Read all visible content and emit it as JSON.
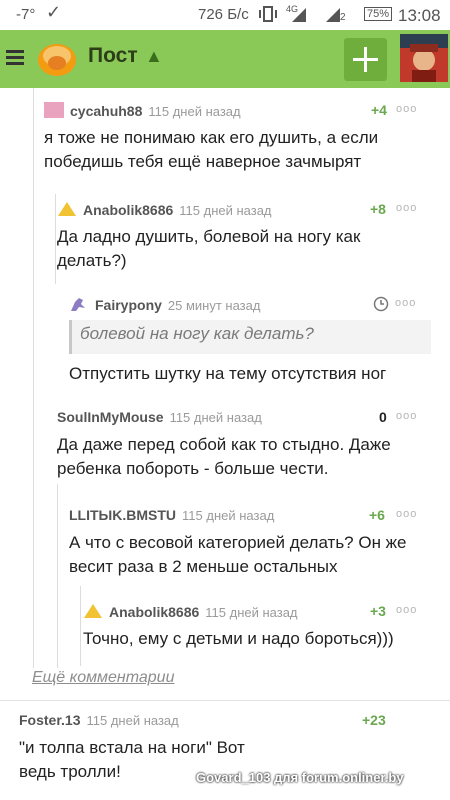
{
  "status_bar": {
    "temp": "-7°",
    "speed": "726 Б/с",
    "network": "4G",
    "sim": "2",
    "battery": "75%",
    "time": "13:08"
  },
  "app_bar": {
    "title": "Пост",
    "icons": [
      "menu-icon",
      "pikabu-logo",
      "arrow-up-icon",
      "plus-icon",
      "user-avatar"
    ],
    "colors": {
      "bar": "#8ac858",
      "button": "#6fae3d",
      "positive": "#6aa84f"
    }
  },
  "comments": [
    {
      "author": "cycahuh88",
      "age": "115 дней назад",
      "score": "+4",
      "text": "я тоже не понимаю как его душить, а если победишь тебя ещё наверное зачмырят"
    },
    {
      "author": "Anabolik8686",
      "age": "115 дней назад",
      "score": "+8",
      "text": "Да ладно душить, болевой на ногу как делать?)"
    },
    {
      "author": "Fairypony",
      "age": "25 минут назад",
      "score": "",
      "quote": "болевой на ногу как делать?",
      "text": "Отпустить шутку на тему отсутствия ног"
    },
    {
      "author": "SoulInMyMouse",
      "age": "115 дней назад",
      "score": "0",
      "text": "Да даже перед собой как то стыдно. Даже ребенка побороть - больше чести."
    },
    {
      "author": "LLITЫK.BMSTU",
      "age": "115 дней назад",
      "score": "+6",
      "text": "А что с весовой категорией делать? Он же весит раза в 2 меньше остальных"
    },
    {
      "author": "Anabolik8686",
      "age": "115 дней назад",
      "score": "+3",
      "text": "Точно, ему с детьми и надо бороться)))"
    },
    {
      "author": "Foster.13",
      "age": "115 дней назад",
      "score": "+23",
      "text": "\"и толпа встала на ноги\" Вот ведь тролли!"
    }
  ],
  "more_comments_label": "Ещё комментарии",
  "dots_label": "ooo",
  "watermark": "Govard_103 для forum.onliner.by"
}
